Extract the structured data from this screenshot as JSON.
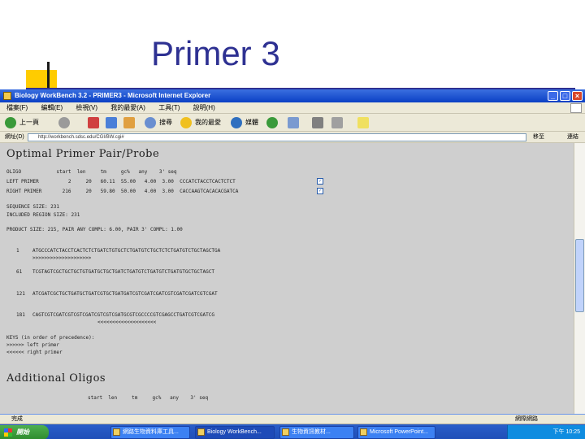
{
  "slide": {
    "title": "Primer 3"
  },
  "window": {
    "title": "Biology WorkBench 3.2 - PRIMER3 - Microsoft Internet Explorer",
    "min": "_",
    "max": "□",
    "close": "×"
  },
  "menu": [
    "檔案(F)",
    "編輯(E)",
    "檢視(V)",
    "我的最愛(A)",
    "工具(T)",
    "說明(H)"
  ],
  "toolbar": {
    "back": "上一頁",
    "search": "搜尋",
    "favorites": "我的最愛",
    "media": "媒體"
  },
  "address": {
    "label": "網址(D)",
    "url": "http://workbench.sdsc.edu/CGI/BW.cgi#",
    "go": "移至",
    "links": "連結"
  },
  "content": {
    "heading1": "Optimal Primer Pair/Probe",
    "table_header": "OLIGO            start  len     tm     gc%   any    3' seq",
    "left_primer": "LEFT PRIMER          2     20   60.11  55.00   4.00  3.00  CCCATCTACCTCACTCTCT",
    "right_primer": "RIGHT PRIMER       216     20   59.80  50.00   4.00  3.00  CACCAAGTCACACACGATCA",
    "sequence_size": "SEQUENCE SIZE: 231",
    "included_region": "INCLUDED REGION SIZE: 231",
    "product_size": "PRODUCT SIZE: 215, PAIR ANY COMPL: 6.00, PAIR 3' COMPL: 1.00",
    "seq_lines": [
      {
        "pos": "1",
        "seq": "ATGCCCATCTACCTCACTCTCTGATCTGTGCTCTGATGTCTGCTCTCTGATGTCTGCTAGCTGA",
        "mark": ">>>>>>>>>>>>>>>>>>>>"
      },
      {
        "pos": "61",
        "seq": "TCGTAGTCGCTGCTGCTGTGATGCTGCTGATCTGATGTCTGATGTCTGATGTGCTGCTAGCT",
        "mark": ""
      },
      {
        "pos": "121",
        "seq": "ATCGATCGCTGCTGATGCTGATCGTGCTGATGATCGTCGATCGATCGTCGATCGATCGTCGAT",
        "mark": ""
      },
      {
        "pos": "181",
        "seq": "CAGTCGTCGATCGTCGTCGATCGTCGTCGATGCGTCGCCCCGTCGAGCCTGATCGTCGATCG",
        "mark": "<<<<<<<<<<<<<<<<<<<<"
      }
    ],
    "key_title": "KEYS (in order of precedence):",
    "key1": ">>>>>> left primer",
    "key2": "<<<<<< right primer",
    "heading2": "Additional Oligos",
    "add_header": "start  len     tm     gc%   any    3' seq"
  },
  "status": {
    "left": "完成",
    "right": "網際網路"
  },
  "taskbar": {
    "start": "開始",
    "tasks": [
      "網路生物資料庫工具...",
      "Biology WorkBench...",
      "生物資訊教材...",
      "Microsoft PowerPoint..."
    ],
    "tray": "下午 10:25"
  }
}
